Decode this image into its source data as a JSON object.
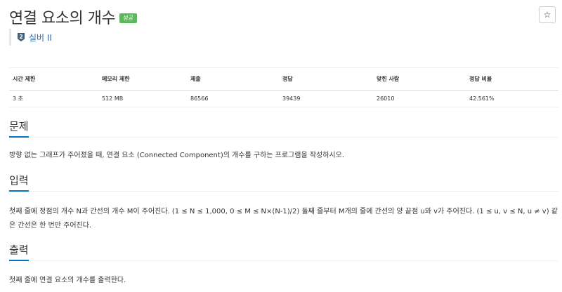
{
  "problem": {
    "title": "연결 요소의 개수",
    "result_badge": "성공",
    "tier_icon": "silver-2-tier-icon",
    "tier_label": "실버 II",
    "star_icon": "☆"
  },
  "info_table": {
    "headers": [
      "시간 제한",
      "메모리 제한",
      "제출",
      "정답",
      "맞힌 사람",
      "정답 비율"
    ],
    "values": [
      "3 초",
      "512 MB",
      "86566",
      "39439",
      "26010",
      "42.561%"
    ]
  },
  "sections": {
    "description": {
      "title": "문제",
      "body": "방향 없는 그래프가 주어졌을 때, 연결 요소 (Connected Component)의 개수를 구하는 프로그램을 작성하시오."
    },
    "input": {
      "title": "입력",
      "body": "첫째 줄에 정점의 개수 N과 간선의 개수 M이 주어진다. (1 ≤ N ≤ 1,000, 0 ≤ M ≤ N×(N-1)/2) 둘째 줄부터 M개의 줄에 간선의 양 끝점 u와 v가 주어진다. (1 ≤ u, v ≤ N, u ≠ v) 같은 간선은 한 번만 주어진다."
    },
    "output": {
      "title": "출력",
      "body": "첫째 줄에 연결 요소의 개수를 출력한다."
    }
  },
  "colors": {
    "accent": "#0076c0",
    "success_badge": "#5cb85c",
    "tier_silver": "#435f7a",
    "link": "#2e6da4"
  }
}
